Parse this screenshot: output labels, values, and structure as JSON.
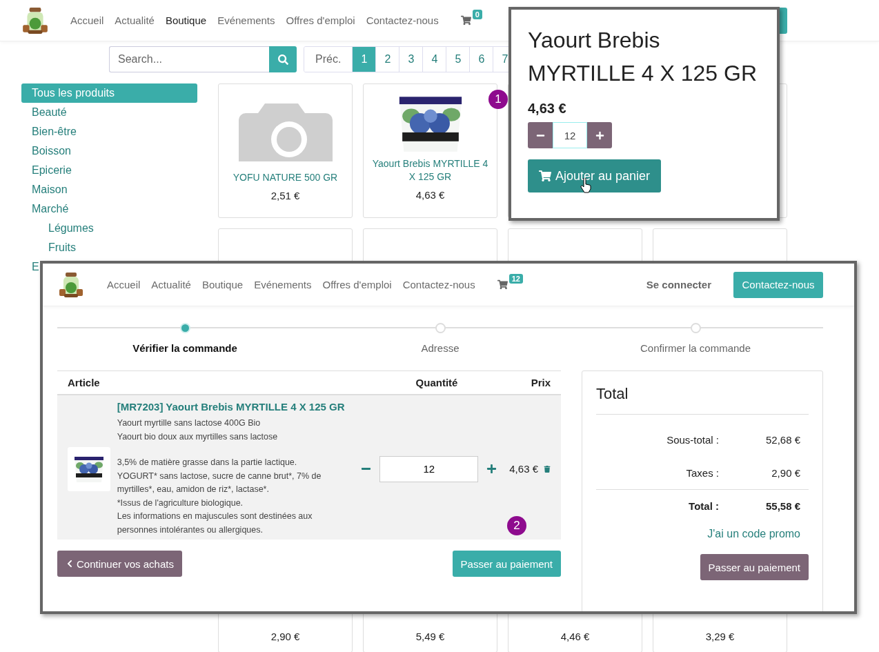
{
  "nav": {
    "links": [
      {
        "label": "Accueil",
        "selected": false
      },
      {
        "label": "Actualité",
        "selected": false
      },
      {
        "label": "Boutique",
        "selected": true
      },
      {
        "label": "Evénements",
        "selected": false
      },
      {
        "label": "Offres d'emploi",
        "selected": false
      },
      {
        "label": "Contactez-nous",
        "selected": false
      }
    ],
    "cart_count": "0"
  },
  "search": {
    "placeholder": "Search..."
  },
  "pagination": {
    "prev": "Préc.",
    "pages": [
      {
        "label": "1",
        "selected": true
      },
      {
        "label": "2",
        "selected": false
      },
      {
        "label": "3",
        "selected": false
      },
      {
        "label": "4",
        "selected": false
      },
      {
        "label": "5",
        "selected": false
      },
      {
        "label": "6",
        "selected": false
      },
      {
        "label": "7",
        "selected": false
      }
    ]
  },
  "categories": [
    {
      "label": "Tous les produits",
      "selected": true
    },
    {
      "label": "Beauté",
      "selected": false
    },
    {
      "label": "Bien-être",
      "selected": false
    },
    {
      "label": "Boisson",
      "selected": false
    },
    {
      "label": "Epicerie",
      "selected": false
    },
    {
      "label": "Maison",
      "selected": false
    },
    {
      "label": "Marché",
      "selected": false,
      "children": [
        {
          "label": "Légumes",
          "selected": false
        },
        {
          "label": "Fruits",
          "selected": false
        }
      ]
    },
    {
      "label": "E",
      "selected": false
    }
  ],
  "product_rows": [
    [
      {
        "kind": "placeholder",
        "name": "YOFU NATURE 500 GR",
        "price": "2,51 €"
      },
      {
        "name": "Yaourt Brebis MYRTILLE 4 X 125 GR",
        "price": "4,63 €"
      },
      {
        "kind": "hidden"
      },
      {
        "kind": "hidden"
      }
    ],
    [
      {
        "kind": "hidden"
      },
      {
        "kind": "hidden"
      },
      {
        "kind": "hidden"
      },
      {
        "kind": "hidden"
      }
    ],
    [
      {
        "kind": "price_only",
        "price": "2,90 €"
      },
      {
        "kind": "price_only",
        "price": "5,49 €"
      },
      {
        "kind": "price_only",
        "price": "4,46 €"
      },
      {
        "kind": "price_only",
        "price": "3,29 €"
      }
    ]
  ],
  "popup": {
    "title": "Yaourt Brebis MYRTILLE 4 X 125 GR",
    "price": "4,63 €",
    "quantity": "12",
    "add_button": "Ajouter au panier"
  },
  "callouts": [
    {
      "label": "1"
    },
    {
      "label": "2"
    }
  ],
  "cart_view": {
    "nav": {
      "links": [
        {
          "label": "Accueil",
          "selected": false
        },
        {
          "label": "Actualité",
          "selected": false
        },
        {
          "label": "Boutique",
          "selected": false
        },
        {
          "label": "Evénements",
          "selected": false
        },
        {
          "label": "Offres d'emploi",
          "selected": false
        },
        {
          "label": "Contactez-nous",
          "selected": false
        }
      ],
      "cart_count": "12",
      "login": "Se connecter",
      "contact_button": "Contactez-nous"
    },
    "steps": [
      {
        "label": "Vérifier la commande",
        "selected": true
      },
      {
        "label": "Adresse",
        "selected": false
      },
      {
        "label": "Confirmer la commande",
        "selected": false
      }
    ],
    "columns": [
      "Article",
      "Quantité",
      "Prix"
    ],
    "line": {
      "title": "[MR7203] Yaourt Brebis MYRTILLE 4 X 125 GR",
      "description": [
        [
          "Yaourt myrtille sans lactose 400G Bio",
          "Yaourt bio doux aux myrtilles sans lactose"
        ],
        [
          "3,5% de matière grasse dans la partie lactique.",
          "YOGURT* sans lactose, sucre de canne brut*, 7% de myrtilles*, eau, amidon de riz*, lactase*.",
          "*Issus de l'agriculture biologique.",
          "Les informations en majuscules sont destinées aux personnes intolérantes ou allergiques."
        ]
      ],
      "quantity": "12",
      "price": "4,63 €"
    },
    "continue_button": "Continuer vos achats",
    "checkout_button": "Passer au paiement",
    "totals": {
      "title": "Total",
      "rows": [
        {
          "kind": "normal",
          "label": "Sous-total :",
          "value": "52,68 €"
        },
        {
          "kind": "normal",
          "label": "Taxes :",
          "value": "2,90 €"
        },
        {
          "kind": "grand",
          "label": "Total :",
          "value": "55,58 €"
        }
      ],
      "promo": "J'ai un code promo",
      "checkout_button": "Passer au paiement"
    }
  }
}
